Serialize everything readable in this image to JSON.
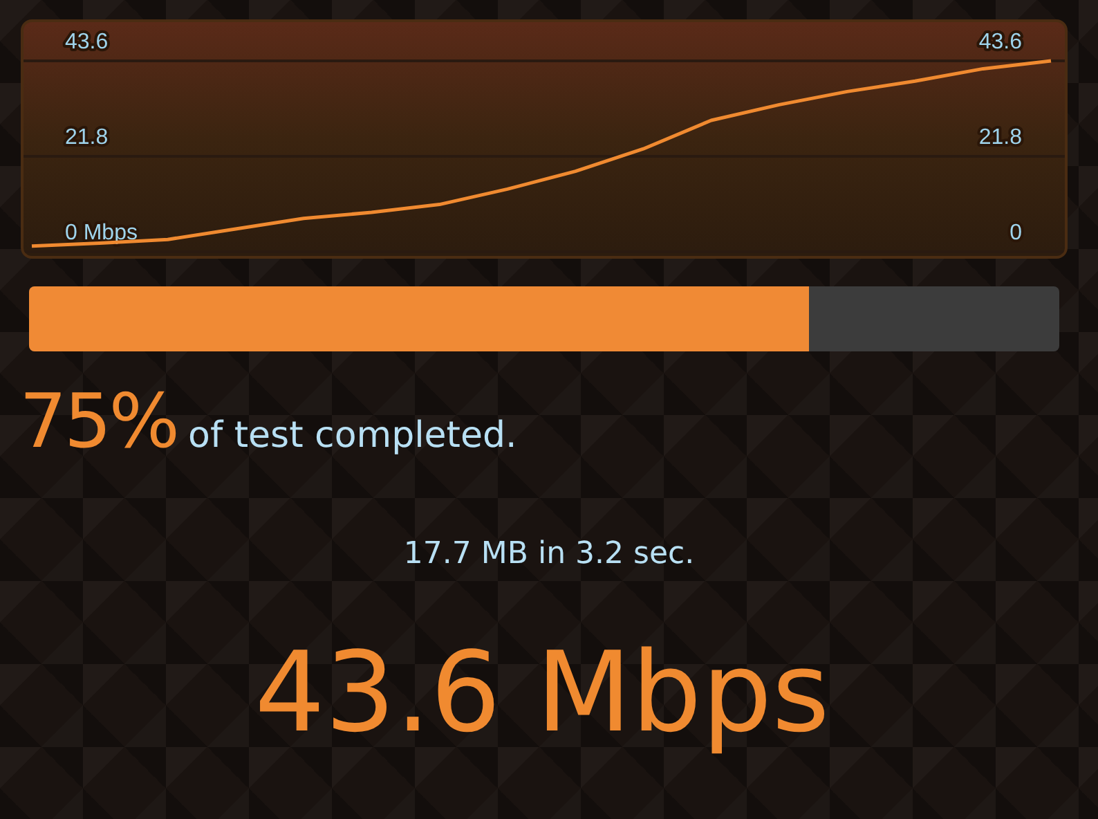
{
  "chart": {
    "right_axis_labels": [
      "43.6",
      "21.8",
      "0"
    ],
    "chart_data": {
      "type": "line",
      "ylim": [
        0,
        43.6
      ],
      "yticks": [
        {
          "value": 0,
          "label": "0 Mbps"
        },
        {
          "value": 21.8,
          "label": "21.8"
        },
        {
          "value": 43.6,
          "label": "43.6"
        }
      ],
      "series": [
        {
          "color": "#f08a30",
          "values": [
            1.3,
            2.0,
            2.8,
            5.2,
            7.6,
            9.0,
            10.8,
            14.3,
            18.4,
            23.5,
            30.0,
            33.6,
            36.6,
            39.0,
            41.8,
            43.6
          ]
        }
      ]
    }
  },
  "progress": {
    "level": 0.757
  },
  "percent": "75%",
  "percent_caption": "of test completed.",
  "transfer": "17.7 MB in 3.2 sec.",
  "speed": "43.6 Mbps"
}
